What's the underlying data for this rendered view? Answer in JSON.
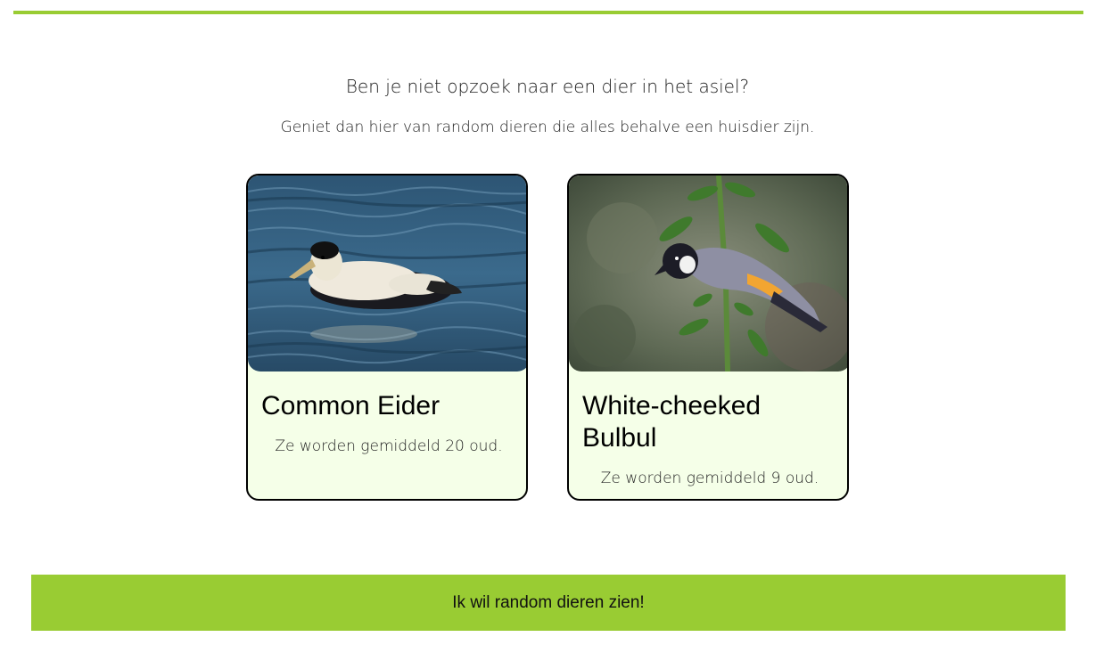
{
  "intro": {
    "heading": "Ben je niet opzoek naar een dier in het asiel?",
    "subheading": "Geniet dan hier van random dieren die alles behalve een huisdier zijn."
  },
  "cards": [
    {
      "name": "Common Eider",
      "age_text": "Ze worden gemiddeld 20 oud."
    },
    {
      "name": "White-cheeked Bulbul",
      "age_text": "Ze worden gemiddeld 9 oud."
    }
  ],
  "action_button": {
    "label": "Ik wil random dieren zien!"
  },
  "colors": {
    "accent": "#99cc33",
    "card_background": "#f5ffe8",
    "card_border": "#000000"
  }
}
